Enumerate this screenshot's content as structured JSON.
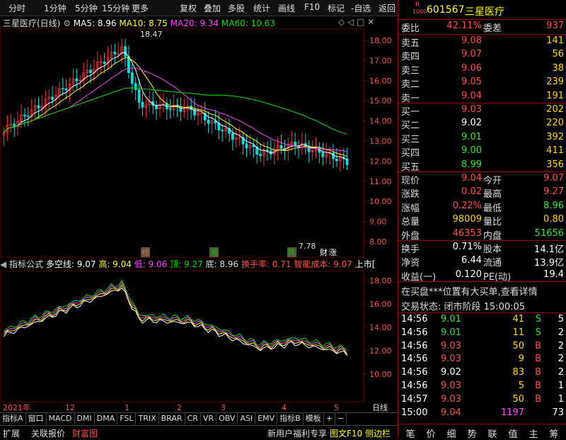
{
  "toolbar": {
    "items": [
      "分时",
      "1分钟",
      "5分钟",
      "15分钟",
      "更多",
      "复权",
      "叠加",
      "多股",
      "统计",
      "画线",
      "F10",
      "标记",
      "-自选",
      "返回"
    ]
  },
  "chart": {
    "name": "三星医疗(日线)",
    "ma5": "MA5: 8.96",
    "ma10": "MA10: 8.75",
    "ma20": "MA20: 9.34",
    "ma60": "MA60: 10.63",
    "high_label": "18.47",
    "low_label": "7.78",
    "y_ticks": [
      "18.00",
      "17.00",
      "16.00",
      "15.00",
      "14.00",
      "13.00",
      "12.00",
      "11.00",
      "10.00",
      "9.00",
      "8.00"
    ],
    "markers": [
      "榜",
      "减",
      "跌",
      "财",
      "涨"
    ],
    "colors": {
      "ma5": "#ffffff",
      "ma10": "#ffff00",
      "ma20": "#ff44ff",
      "ma60": "#00e000",
      "up": "#ff3030",
      "down": "#00e0e0"
    }
  },
  "indicator": {
    "title": "指标公式",
    "duokong": "多空线: 9.07",
    "high": "高: 9.04",
    "low": "低: 9.06",
    "top": "顶: 9.27",
    "bottom": "底: 8.96",
    "turnover": "换手率: 0.71",
    "cost": "智能成本: 9.07",
    "listing": "上市[",
    "y_ticks": [
      "18.00",
      "16.00",
      "14.00",
      "12.00",
      "10.00"
    ]
  },
  "x_axis": {
    "labels": [
      "2021年",
      "12",
      "1",
      "2",
      "3",
      "4",
      "5"
    ],
    "right": "日线"
  },
  "bottom_tabs": [
    "指标A",
    "窗口",
    "MACD",
    "DMI",
    "DMA",
    "FSL",
    "TRIX",
    "BRAR",
    "CR",
    "VR",
    "OBV",
    "ASI",
    "EMV",
    "指标B",
    "模板",
    "+",
    "−"
  ],
  "status_bar": {
    "left": [
      "扩展",
      "关联报价",
      "财富图"
    ],
    "right": [
      "新用户福利专享",
      "图文F10",
      "侧边栏"
    ]
  },
  "quote": {
    "code": "601567",
    "name": "三星医疗",
    "badge_r": "R",
    "badge_num": "1000",
    "weibi_label": "委比",
    "weibi": "42.11%",
    "weicha_label": "委差",
    "weicha": "937",
    "asks": [
      {
        "label": "卖五",
        "price": "9.08",
        "vol": "141"
      },
      {
        "label": "卖四",
        "price": "9.07",
        "vol": "56"
      },
      {
        "label": "卖三",
        "price": "9.06",
        "vol": "38"
      },
      {
        "label": "卖二",
        "price": "9.05",
        "vol": "239"
      },
      {
        "label": "卖一",
        "price": "9.04",
        "vol": "191"
      }
    ],
    "bids": [
      {
        "label": "买一",
        "price": "9.03",
        "vol": "202"
      },
      {
        "label": "买二",
        "price": "9.02",
        "vol": "220"
      },
      {
        "label": "买三",
        "price": "9.01",
        "vol": "392"
      },
      {
        "label": "买四",
        "price": "9.00",
        "vol": "411"
      },
      {
        "label": "买五",
        "price": "8.99",
        "vol": "356"
      }
    ],
    "stats": [
      {
        "l1": "现价",
        "v1": "9.04",
        "l2": "今开",
        "v2": "9.07"
      },
      {
        "l1": "涨跌",
        "v1": "0.02",
        "l2": "最高",
        "v2": "9.27"
      },
      {
        "l1": "涨幅",
        "v1": "0.22%",
        "l2": "最低",
        "v2": "8.96"
      },
      {
        "l1": "总量",
        "v1": "98009",
        "l2": "量比",
        "v2": "0.80"
      },
      {
        "l1": "外盘",
        "v1": "46353",
        "l2": "内盘",
        "v2": "51656"
      }
    ],
    "fund": [
      {
        "l1": "换手",
        "v1": "0.71%",
        "l2": "股本",
        "v2": "14.1亿"
      },
      {
        "l1": "净资",
        "v1": "6.44",
        "l2": "流通",
        "v2": "13.9亿"
      },
      {
        "l1": "收益(一)",
        "v1": "0.120",
        "l2": "PE(动)",
        "v2": "19.4"
      }
    ],
    "notice": "在买盘***位置有大买单,查看详情",
    "trade_state": "交易状态: 闭市阶段 15:00:05",
    "ticks": [
      {
        "t": "14:56",
        "p": "9.01",
        "v": "41",
        "bs": "S"
      },
      {
        "t": "14:56",
        "p": "9.01",
        "v": "11",
        "bs": "S"
      },
      {
        "t": "14:56",
        "p": "9.03",
        "v": "50",
        "bs": "B"
      },
      {
        "t": "14:56",
        "p": "9.03",
        "v": "9",
        "bs": "B"
      },
      {
        "t": "14:56",
        "p": "9.02",
        "v": "83",
        "bs": "B"
      },
      {
        "t": "14:56",
        "p": "9.03",
        "v": "5",
        "bs": "B"
      },
      {
        "t": "14:57",
        "p": "9.03",
        "v": "50",
        "bs": "B"
      },
      {
        "t": "15:00",
        "p": "9.04",
        "v": "1197",
        "bs": ""
      }
    ],
    "tick_extra": [
      "5",
      "2",
      "2",
      "2",
      "2",
      "1",
      "1",
      "73"
    ],
    "right_tabs": [
      "笔",
      "价",
      "细",
      "势",
      "联",
      "值",
      "主",
      "筹"
    ]
  }
}
